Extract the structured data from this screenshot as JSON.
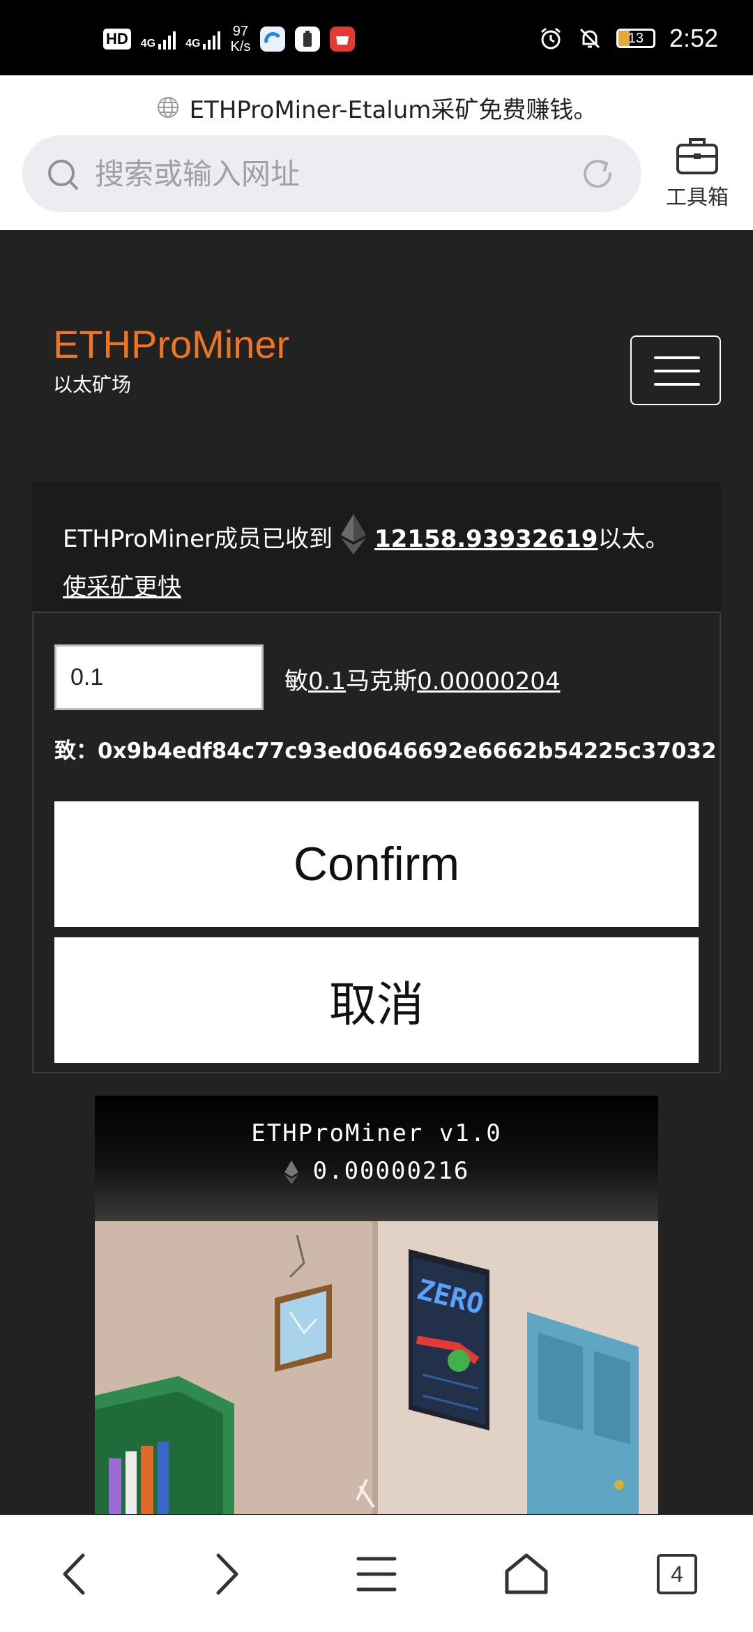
{
  "status_bar": {
    "hd": "HD",
    "net1": "4G",
    "net2": "4G",
    "speed_value": "97",
    "speed_unit": "K/s",
    "battery": "13",
    "time": "2:52"
  },
  "browser": {
    "page_title": "ETHProMiner-Etalum采矿免费赚钱。",
    "address_placeholder": "搜索或输入网址",
    "toolbox_label": "工具箱",
    "tab_count": "4"
  },
  "site": {
    "brand": "ETHProMiner",
    "tagline": "以太矿场"
  },
  "info": {
    "prefix": "ETHProMiner成员已收到",
    "amount": "12158.93932619",
    "unit": "以太。",
    "link": "使采矿更快"
  },
  "form": {
    "amount_value": "0.1",
    "rate_min_label": "敏",
    "rate_min": "0.1",
    "rate_max_label": "马克斯",
    "rate_max": "0.00000204",
    "to_label": "致：",
    "to_address": "0x9b4edf84c77c93ed0646692e6662b54225c37032",
    "confirm_label": "Confirm",
    "cancel_label": "取消"
  },
  "game": {
    "title": "ETHProMiner v1.0",
    "balance": "0.00000216",
    "poster_text": "ZERO"
  },
  "colors": {
    "brand_orange": "#ee7623",
    "page_bg": "#222222",
    "info_bg": "#1b1b1b"
  }
}
